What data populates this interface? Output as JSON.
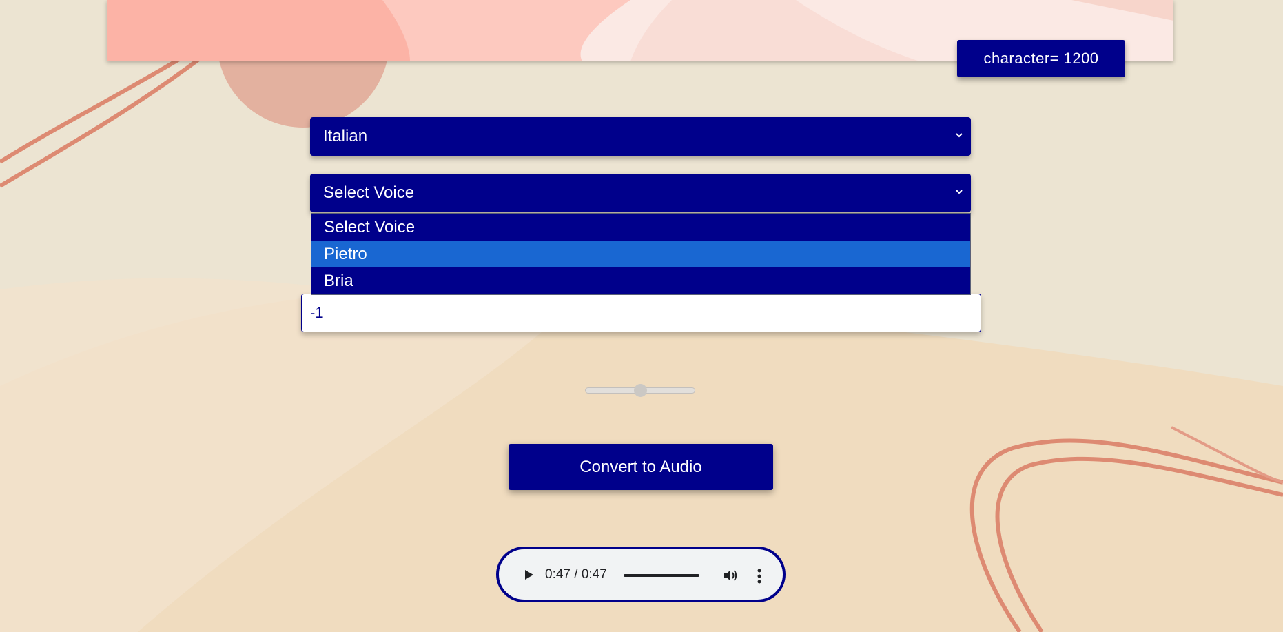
{
  "header": {
    "character_badge": "character= 1200"
  },
  "language_select": {
    "selected": "Italian"
  },
  "voice_select": {
    "selected": "Select Voice",
    "options": [
      "Select Voice",
      "Pietro",
      "Bria"
    ],
    "highlighted_option": "Pietro"
  },
  "text_input": {
    "value": "-1"
  },
  "speed_slider": {
    "value_fraction": 0.5
  },
  "convert_button": {
    "label": "Convert to Audio"
  },
  "audio_player": {
    "time": "0:47 / 0:47",
    "play_icon": "play-icon",
    "volume_icon": "volume-icon",
    "more_icon": "more-vert-icon"
  },
  "colors": {
    "primary": "#00008b",
    "highlight": "#1967d2",
    "background": "#efd9b8"
  }
}
